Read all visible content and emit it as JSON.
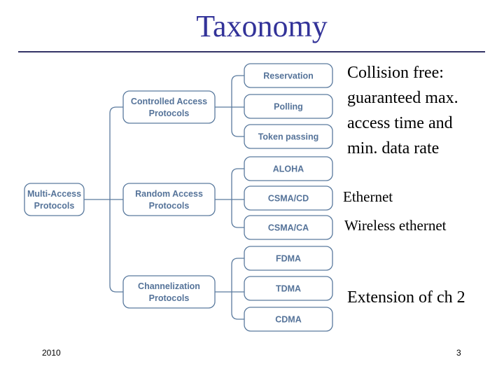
{
  "slide": {
    "title": "Taxonomy",
    "title_color": "#333399",
    "footer_left": "2010",
    "footer_right": "3"
  },
  "diagram": {
    "root": {
      "line1": "Multi-Access",
      "line2": "Protocols"
    },
    "categories": [
      {
        "line1": "Controlled Access",
        "line2": "Protocols",
        "children": [
          "Reservation",
          "Polling",
          "Token passing"
        ]
      },
      {
        "line1": "Random Access",
        "line2": "Protocols",
        "children": [
          "ALOHA",
          "CSMA/CD",
          "CSMA/CA"
        ]
      },
      {
        "line1": "Channelization",
        "line2": "Protocols",
        "children": [
          "FDMA",
          "TDMA",
          "CDMA"
        ]
      }
    ],
    "stroke_color": "#5a7a9e",
    "text_color": "#557399"
  },
  "notes": {
    "controlled": [
      "Collision free:",
      "guaranteed max.",
      "access time and",
      "min. data rate"
    ],
    "csma_cd": "Ethernet",
    "csma_ca": "Wireless ethernet",
    "channelization": "Extension of ch 2"
  }
}
